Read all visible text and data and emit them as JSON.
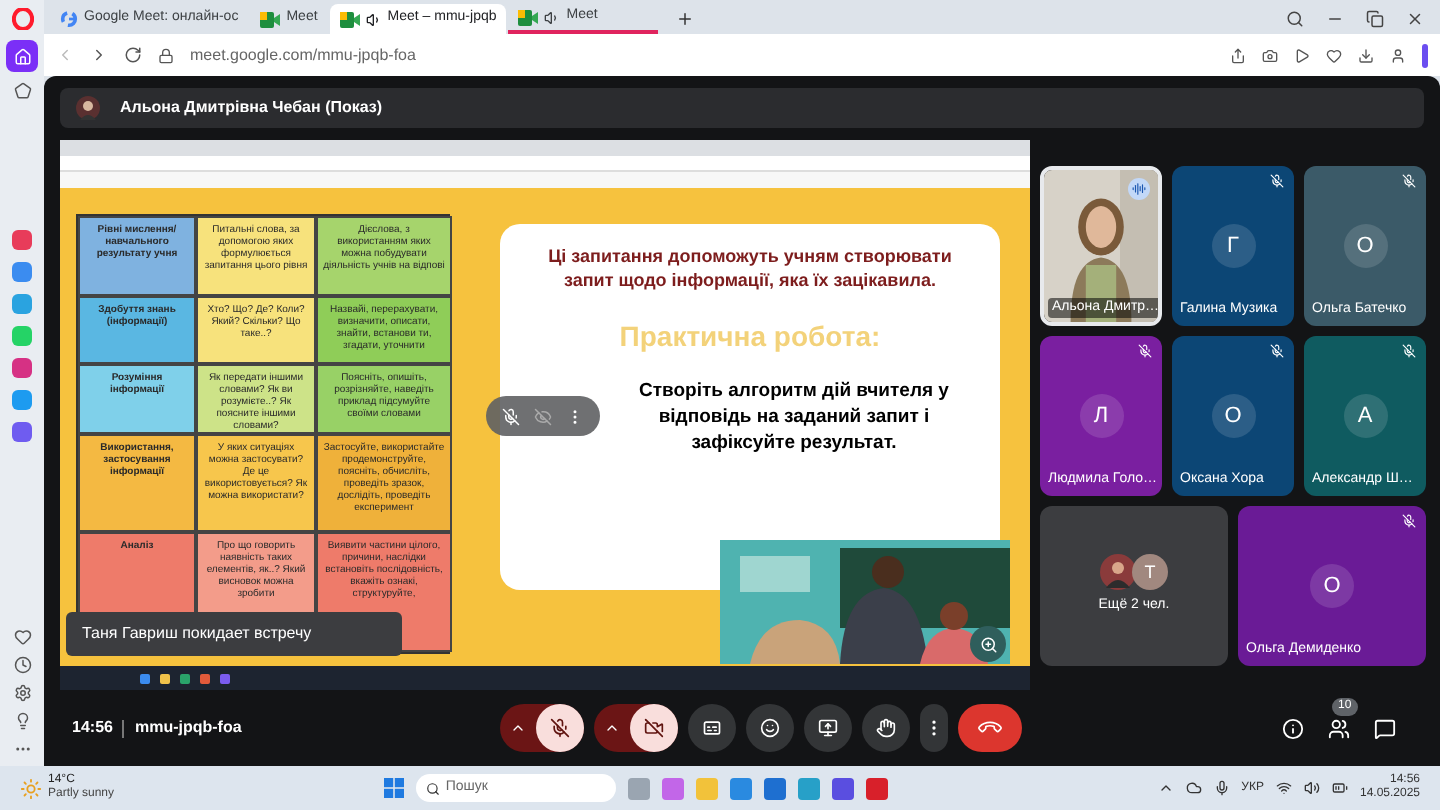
{
  "browser": {
    "tabs": [
      {
        "title": "Google Meet: онлайн-ос",
        "audio": false,
        "accent": false,
        "selected": false
      },
      {
        "title": "Meet",
        "audio": false,
        "accent": false,
        "selected": false
      },
      {
        "title": "Meet – mmu-jpqb",
        "audio": true,
        "accent": false,
        "selected": true
      },
      {
        "title": "Meet",
        "audio": true,
        "accent": true,
        "selected": false
      }
    ],
    "url": "meet.google.com/mmu-jpqb-foa"
  },
  "meet": {
    "presenter": "Альона Дмитрівна Чебан (Показ)",
    "slide": {
      "table": {
        "rows": [
          [
            {
              "text": "Рівні мислення/ навчального результату учня",
              "color": "#7fb2e0"
            },
            {
              "text": "Питальні слова, за допомогою яких формулюється запитання цього рівня",
              "color": "#f7e27c"
            },
            {
              "text": "Дієслова, з використанням яких можна побудувати діяльність учнів на відпові",
              "color": "#a6d46c"
            }
          ],
          [
            {
              "text": "Здобуття знань (інформації)",
              "color": "#5ab7e2"
            },
            {
              "text": "Хто? Що? Де? Коли? Який? Скільки? Що таке..?",
              "color": "#f7e27c"
            },
            {
              "text": "Назвайі, перерахувати, визначити, описати, знайти, встанови ти, згадати, уточнити",
              "color": "#8fcd58"
            }
          ],
          [
            {
              "text": "Розуміння інформації",
              "color": "#7fd0ea"
            },
            {
              "text": "Як передати іншими словами? Як ви розумієте..? Як поясните іншими словами?",
              "color": "#cde388"
            },
            {
              "text": "Поясніть, опишіть, розрізняйте, наведіть приклад підсумуйте своїми словами",
              "color": "#98d166"
            }
          ],
          [
            {
              "text": "Використання, застосування інформації",
              "color": "#f4b942"
            },
            {
              "text": "У яких ситуаціях можна застосувати? Де це використовується? Як можна використати?",
              "color": "#f7c64c"
            },
            {
              "text": "Застосуйте, використайте продемонструйте, поясніть, обчисліть, проведіть зразок, дослідіть, проведіть експеримент",
              "color": "#efb13a"
            }
          ],
          [
            {
              "text": "Аналіз",
              "color": "#ee7b6a"
            },
            {
              "text": "Про що говорить наявність таких елементів, як..? Який висновок можна зробити",
              "color": "#f39c8a"
            },
            {
              "text": "Виявити частини цілого, причини, наслідки встановіть послідовність, вкажіть ознакі, структуруйте,",
              "color": "#ee7b6a"
            }
          ]
        ]
      },
      "intro": "Ці запитання допоможуть учням створювати запит щодо інформації, яка їх зацікавила.",
      "heading": "Практична робота:",
      "task": "Створіть алгоритм дій вчителя у відповідь на заданий запит і зафіксуйте результат."
    },
    "toast": "Таня Гавриш покидает встречу",
    "participants": [
      {
        "kind": "video",
        "name": "Альона Дмитр…",
        "muted": false
      },
      {
        "kind": "avatar",
        "name": "Галина Музика",
        "initial": "Г",
        "color": "#0c4675",
        "muted": true
      },
      {
        "kind": "avatar",
        "name": "Ольга Батечко",
        "initial": "О",
        "color": "#3b5a68",
        "muted": true
      },
      {
        "kind": "avatar",
        "name": "Людмила Голо…",
        "initial": "Л",
        "color": "#7a1fa0",
        "muted": true
      },
      {
        "kind": "avatar",
        "name": "Оксана Хора",
        "initial": "О",
        "color": "#0c4675",
        "muted": true
      },
      {
        "kind": "avatar",
        "name": "Александр Ш…",
        "initial": "А",
        "color": "#0f5b60",
        "muted": true
      },
      {
        "kind": "more",
        "name": "Ещё 2 чел.",
        "initial": "Т"
      },
      {
        "kind": "avatar",
        "name": "Ольга Демиденко",
        "initial": "О",
        "color": "#6a1b96",
        "muted": true
      }
    ],
    "time": "14:56",
    "code": "mmu-jpqb-foa",
    "mic_on": false,
    "camera_on": false,
    "people_count": "10"
  },
  "taskbar": {
    "temperature": "14°C",
    "weather": "Partly sunny",
    "search_placeholder": "Пошук",
    "language": "УКР",
    "time": "14:56",
    "date": "14.05.2025"
  }
}
